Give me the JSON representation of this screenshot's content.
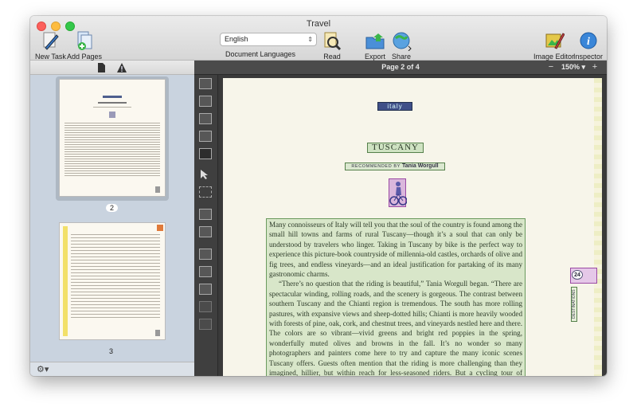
{
  "window": {
    "title": "Travel"
  },
  "toolbar": {
    "new_task": "New Task",
    "add_pages": "Add Pages",
    "language_value": "English",
    "language_label": "Document Languages",
    "read": "Read",
    "export": "Export",
    "share": "Share",
    "image_editor": "Image Editor",
    "inspector": "Inspector"
  },
  "sidebar": {
    "pages": [
      {
        "number": "2",
        "selected": true
      },
      {
        "number": "3",
        "selected": false
      }
    ]
  },
  "viewer": {
    "page_indicator": "Page 2 of 4",
    "zoom": "150% ▾",
    "zoom_minus": "−",
    "zoom_plus": "+"
  },
  "document": {
    "tag": "italy",
    "title": "TUSCANY",
    "recommended_by": "RECOMMENDED BY",
    "author": "Tania Worgull",
    "paragraph1": "Many connoisseurs of Italy will tell you that the soul of the country is found among the small hill towns and farms of rural Tuscany—though it’s a soul that can only be understood by travelers who linger. Taking in Tuscany by bike is the perfect way to experience this picture-book countryside of millennia-old castles, orchards of olive and fig trees, and endless vineyards—and an ideal justification for partaking of its many gastronomic charms.",
    "paragraph2": "“There’s no question that the riding is beautiful,” Tania Worgull began. “There are spectacular winding, rolling roads, and the scenery is gorgeous. The contrast between southern Tuscany and the Chianti region is tremendous. The south has more rolling pastures, with expansive views and sheep-dotted hills; Chianti is more heavily wooded with forests of pine, oak, cork, and chestnut trees, and vineyards nestled here and there. The colors are so vibrant—vivid greens and bright red poppies in the spring, wonderfully muted olives and browns in the fall. It’s no wonder so many photographers and painters come here to try and capture the many iconic scenes Tuscany offers. Guests often mention that the riding is more challenging than they imagined, hillier, but within reach for less-seasoned riders. But a cycling tour of Tuscany goes beyond what you experience in",
    "side_number": "24",
    "side_text": "DESTINATIONS"
  },
  "colors": {
    "text_area": "#d8e6c9",
    "picture_area": "#dab7dc",
    "title_area": "#cfe3c2"
  }
}
